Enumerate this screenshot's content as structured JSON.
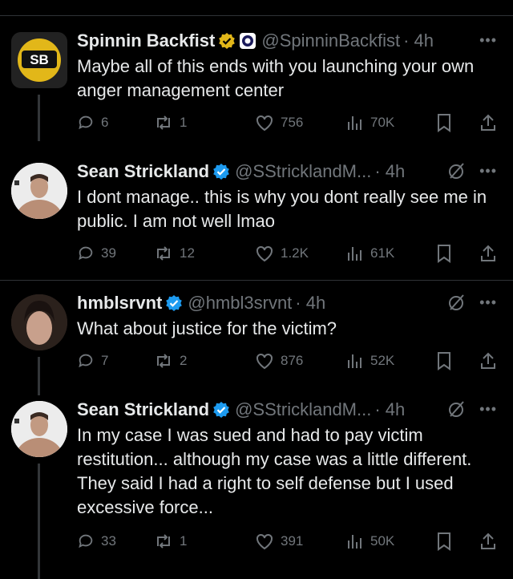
{
  "tweets": [
    {
      "name": "Spinnin Backfist",
      "handle": "@SpinninBackfist",
      "time": "· 4h",
      "text": "Maybe all of this ends with you launching your own anger management center",
      "stats": {
        "replies": "6",
        "reposts": "1",
        "likes": "756",
        "views": "70K"
      },
      "avatar_text": "SB"
    },
    {
      "name": "Sean Strickland",
      "handle": "@SStricklandM...",
      "time": "· 4h",
      "text": "I dont manage.. this is why you dont really see me in public. I am not well lmao",
      "stats": {
        "replies": "39",
        "reposts": "12",
        "likes": "1.2K",
        "views": "61K"
      }
    },
    {
      "name": "hmblsrvnt",
      "handle": "@hmbl3srvnt",
      "time": "· 4h",
      "text": "What about justice for the victim?",
      "stats": {
        "replies": "7",
        "reposts": "2",
        "likes": "876",
        "views": "52K"
      }
    },
    {
      "name": "Sean Strickland",
      "handle": "@SStricklandM...",
      "time": "· 4h",
      "text": "In my case I was sued and had to pay victim restitution... although my case was a little different. They said I had a right to self defense but I used excessive force...",
      "stats": {
        "replies": "33",
        "reposts": "1",
        "likes": "391",
        "views": "50K"
      }
    }
  ],
  "colors": {
    "verified": "#1d9bf0",
    "gold": "#e2b719",
    "muted": "#71767b",
    "text": "#e7e9ea"
  }
}
